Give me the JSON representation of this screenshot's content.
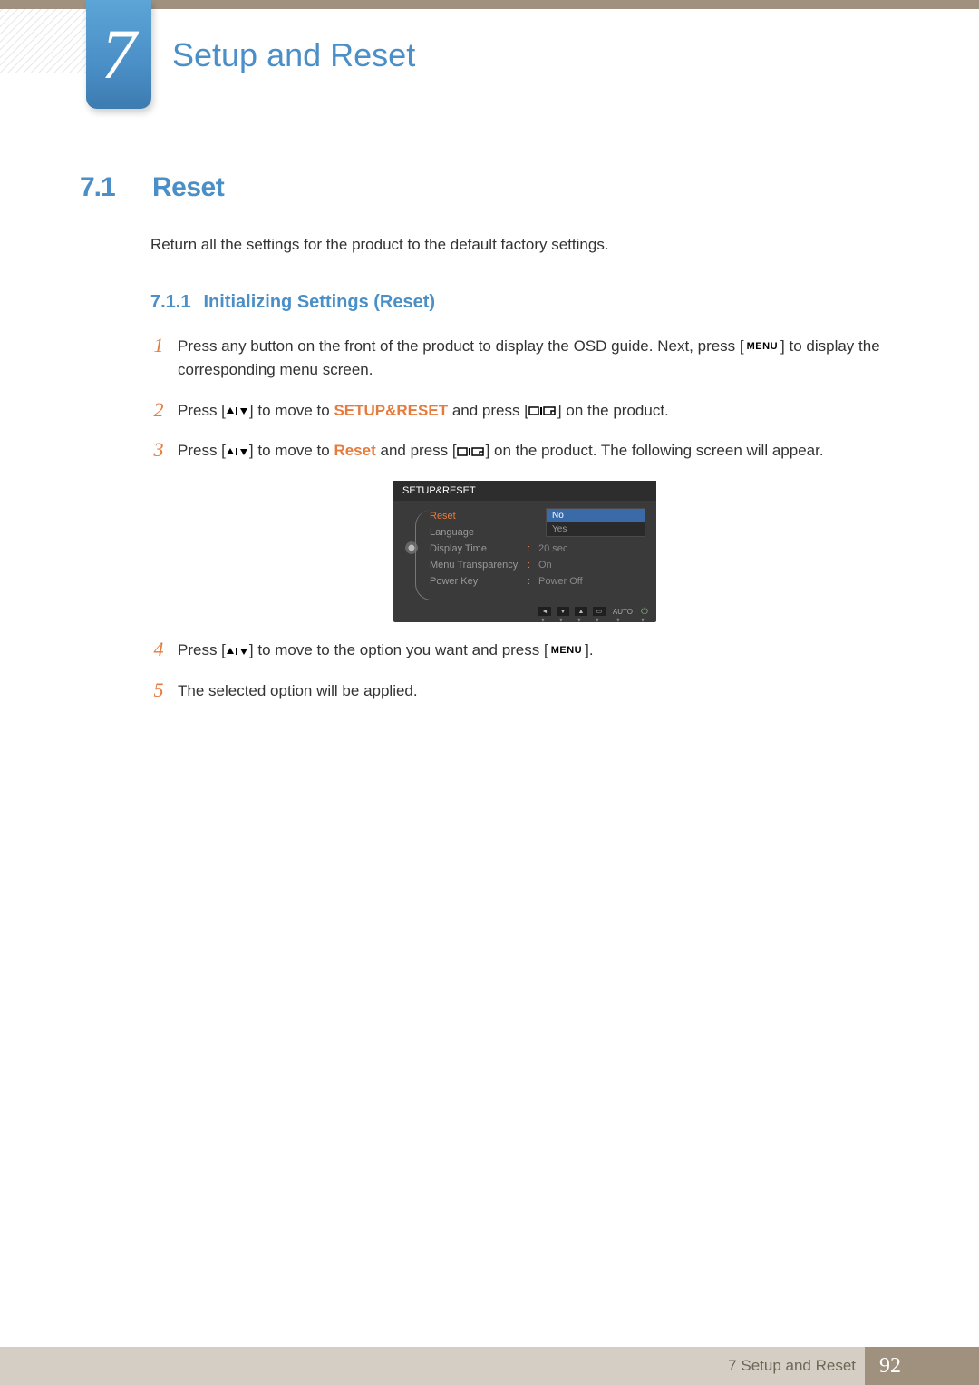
{
  "chapter": {
    "number": "7",
    "title": "Setup and Reset"
  },
  "section": {
    "number": "7.1",
    "title": "Reset",
    "description": "Return all the settings for the product to the default factory settings."
  },
  "subsection": {
    "number": "7.1.1",
    "title": "Initializing Settings (Reset)"
  },
  "steps": {
    "s1_a": "Press any button on the front of the product to display the OSD guide. Next, press [",
    "s1_menu": "MENU",
    "s1_b": "] to display the corresponding menu screen.",
    "s2_a": "Press [",
    "s2_b": "] to move to ",
    "s2_bold": "SETUP&RESET",
    "s2_c": " and press [",
    "s2_d": "] on the product.",
    "s3_a": "Press [",
    "s3_b": "] to move to ",
    "s3_bold": "Reset",
    "s3_c": " and press [",
    "s3_d": "] on the product. The following screen will appear.",
    "s4_a": "Press [",
    "s4_b": "] to move to the option you want and press [",
    "s4_menu": "MENU",
    "s4_c": "].",
    "s5": "The selected option will be applied."
  },
  "step_numbers": {
    "n1": "1",
    "n2": "2",
    "n3": "3",
    "n4": "4",
    "n5": "5"
  },
  "osd": {
    "title": "SETUP&RESET",
    "menu": {
      "reset": "Reset",
      "language": "Language",
      "display_time": "Display Time",
      "menu_transparency": "Menu Transparency",
      "power_key": "Power Key"
    },
    "values": {
      "display_time": "20 sec",
      "menu_transparency": "On",
      "power_key": "Power Off"
    },
    "dropdown": {
      "no": "No",
      "yes": "Yes"
    },
    "footer_auto": "AUTO"
  },
  "footer": {
    "text": "7 Setup and Reset",
    "page": "92"
  }
}
